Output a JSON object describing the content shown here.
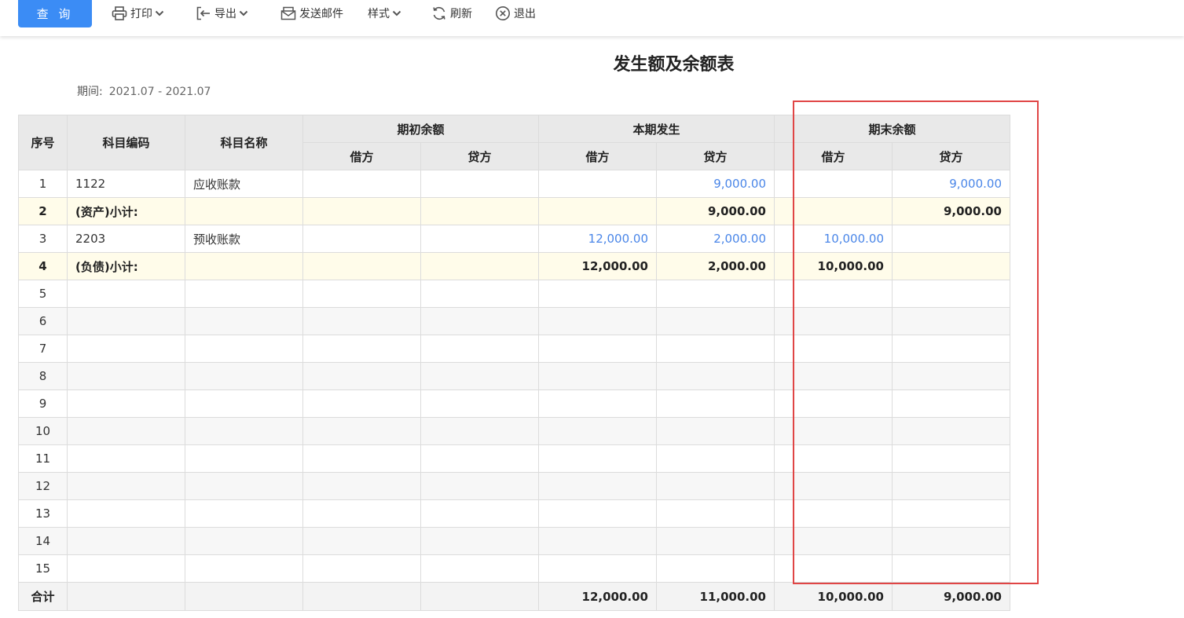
{
  "toolbar": {
    "query_label": "查 询",
    "print_label": "打印",
    "export_label": "导出",
    "email_label": "发送邮件",
    "style_label": "样式",
    "refresh_label": "刷新",
    "exit_label": "退出"
  },
  "report": {
    "title": "发生额及余额表",
    "period_label": "期间:",
    "period_value": "2021.07 - 2021.07"
  },
  "table": {
    "headers": {
      "seq": "序号",
      "code": "科目编码",
      "name": "科目名称",
      "opening": "期初余额",
      "current": "本期发生",
      "closing": "期末余额",
      "debit": "借方",
      "credit": "贷方"
    },
    "rows": [
      {
        "seq": "1",
        "code": "1122",
        "name": "应收账款",
        "open_d": "",
        "open_c": "",
        "cur_d": "",
        "cur_c": "9,000.00",
        "close_d": "",
        "close_c": "9,000.00"
      },
      {
        "seq": "2",
        "code": "(资产)小计:",
        "name": "",
        "open_d": "",
        "open_c": "",
        "cur_d": "",
        "cur_c": "9,000.00",
        "close_d": "",
        "close_c": "9,000.00"
      },
      {
        "seq": "3",
        "code": "2203",
        "name": "预收账款",
        "open_d": "",
        "open_c": "",
        "cur_d": "12,000.00",
        "cur_c": "2,000.00",
        "close_d": "10,000.00",
        "close_c": ""
      },
      {
        "seq": "4",
        "code": "(负债)小计:",
        "name": "",
        "open_d": "",
        "open_c": "",
        "cur_d": "12,000.00",
        "cur_c": "2,000.00",
        "close_d": "10,000.00",
        "close_c": ""
      },
      {
        "seq": "5",
        "code": "",
        "name": "",
        "open_d": "",
        "open_c": "",
        "cur_d": "",
        "cur_c": "",
        "close_d": "",
        "close_c": ""
      },
      {
        "seq": "6",
        "code": "",
        "name": "",
        "open_d": "",
        "open_c": "",
        "cur_d": "",
        "cur_c": "",
        "close_d": "",
        "close_c": ""
      },
      {
        "seq": "7",
        "code": "",
        "name": "",
        "open_d": "",
        "open_c": "",
        "cur_d": "",
        "cur_c": "",
        "close_d": "",
        "close_c": ""
      },
      {
        "seq": "8",
        "code": "",
        "name": "",
        "open_d": "",
        "open_c": "",
        "cur_d": "",
        "cur_c": "",
        "close_d": "",
        "close_c": ""
      },
      {
        "seq": "9",
        "code": "",
        "name": "",
        "open_d": "",
        "open_c": "",
        "cur_d": "",
        "cur_c": "",
        "close_d": "",
        "close_c": ""
      },
      {
        "seq": "10",
        "code": "",
        "name": "",
        "open_d": "",
        "open_c": "",
        "cur_d": "",
        "cur_c": "",
        "close_d": "",
        "close_c": ""
      },
      {
        "seq": "11",
        "code": "",
        "name": "",
        "open_d": "",
        "open_c": "",
        "cur_d": "",
        "cur_c": "",
        "close_d": "",
        "close_c": ""
      },
      {
        "seq": "12",
        "code": "",
        "name": "",
        "open_d": "",
        "open_c": "",
        "cur_d": "",
        "cur_c": "",
        "close_d": "",
        "close_c": ""
      },
      {
        "seq": "13",
        "code": "",
        "name": "",
        "open_d": "",
        "open_c": "",
        "cur_d": "",
        "cur_c": "",
        "close_d": "",
        "close_c": ""
      },
      {
        "seq": "14",
        "code": "",
        "name": "",
        "open_d": "",
        "open_c": "",
        "cur_d": "",
        "cur_c": "",
        "close_d": "",
        "close_c": ""
      },
      {
        "seq": "15",
        "code": "",
        "name": "",
        "open_d": "",
        "open_c": "",
        "cur_d": "",
        "cur_c": "",
        "close_d": "",
        "close_c": ""
      }
    ],
    "total": {
      "label": "合计",
      "cur_d": "12,000.00",
      "cur_c": "11,000.00",
      "close_d": "10,000.00",
      "close_c": "9,000.00"
    }
  },
  "colors": {
    "accent": "#3b8cf5",
    "link_value": "#4a86e8",
    "subtotal_bg": "#fffcea",
    "highlight_border": "#e04545"
  },
  "icons": [
    "printer-icon",
    "export-icon",
    "envelope-icon",
    "refresh-icon",
    "close-circle-icon",
    "chevron-down-icon"
  ]
}
